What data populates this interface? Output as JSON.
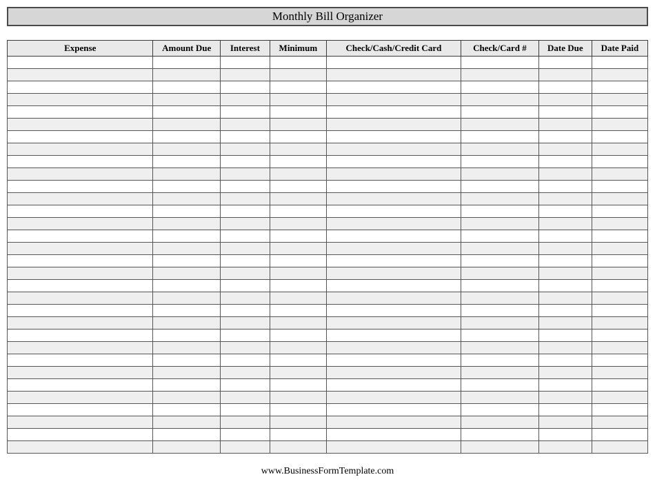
{
  "title": "Monthly Bill Organizer",
  "columns": [
    "Expense",
    "Amount Due",
    "Interest",
    "Minimum",
    "Check/Cash/Credit Card",
    "Check/Card #",
    "Date Due",
    "Date Paid"
  ],
  "rows": [
    [
      "",
      "",
      "",
      "",
      "",
      "",
      "",
      ""
    ],
    [
      "",
      "",
      "",
      "",
      "",
      "",
      "",
      ""
    ],
    [
      "",
      "",
      "",
      "",
      "",
      "",
      "",
      ""
    ],
    [
      "",
      "",
      "",
      "",
      "",
      "",
      "",
      ""
    ],
    [
      "",
      "",
      "",
      "",
      "",
      "",
      "",
      ""
    ],
    [
      "",
      "",
      "",
      "",
      "",
      "",
      "",
      ""
    ],
    [
      "",
      "",
      "",
      "",
      "",
      "",
      "",
      ""
    ],
    [
      "",
      "",
      "",
      "",
      "",
      "",
      "",
      ""
    ],
    [
      "",
      "",
      "",
      "",
      "",
      "",
      "",
      ""
    ],
    [
      "",
      "",
      "",
      "",
      "",
      "",
      "",
      ""
    ],
    [
      "",
      "",
      "",
      "",
      "",
      "",
      "",
      ""
    ],
    [
      "",
      "",
      "",
      "",
      "",
      "",
      "",
      ""
    ],
    [
      "",
      "",
      "",
      "",
      "",
      "",
      "",
      ""
    ],
    [
      "",
      "",
      "",
      "",
      "",
      "",
      "",
      ""
    ],
    [
      "",
      "",
      "",
      "",
      "",
      "",
      "",
      ""
    ],
    [
      "",
      "",
      "",
      "",
      "",
      "",
      "",
      ""
    ],
    [
      "",
      "",
      "",
      "",
      "",
      "",
      "",
      ""
    ],
    [
      "",
      "",
      "",
      "",
      "",
      "",
      "",
      ""
    ],
    [
      "",
      "",
      "",
      "",
      "",
      "",
      "",
      ""
    ],
    [
      "",
      "",
      "",
      "",
      "",
      "",
      "",
      ""
    ],
    [
      "",
      "",
      "",
      "",
      "",
      "",
      "",
      ""
    ],
    [
      "",
      "",
      "",
      "",
      "",
      "",
      "",
      ""
    ],
    [
      "",
      "",
      "",
      "",
      "",
      "",
      "",
      ""
    ],
    [
      "",
      "",
      "",
      "",
      "",
      "",
      "",
      ""
    ],
    [
      "",
      "",
      "",
      "",
      "",
      "",
      "",
      ""
    ],
    [
      "",
      "",
      "",
      "",
      "",
      "",
      "",
      ""
    ],
    [
      "",
      "",
      "",
      "",
      "",
      "",
      "",
      ""
    ],
    [
      "",
      "",
      "",
      "",
      "",
      "",
      "",
      ""
    ],
    [
      "",
      "",
      "",
      "",
      "",
      "",
      "",
      ""
    ],
    [
      "",
      "",
      "",
      "",
      "",
      "",
      "",
      ""
    ],
    [
      "",
      "",
      "",
      "",
      "",
      "",
      "",
      ""
    ],
    [
      "",
      "",
      "",
      "",
      "",
      "",
      "",
      ""
    ]
  ],
  "footer": "www.BusinessFormTemplate.com"
}
